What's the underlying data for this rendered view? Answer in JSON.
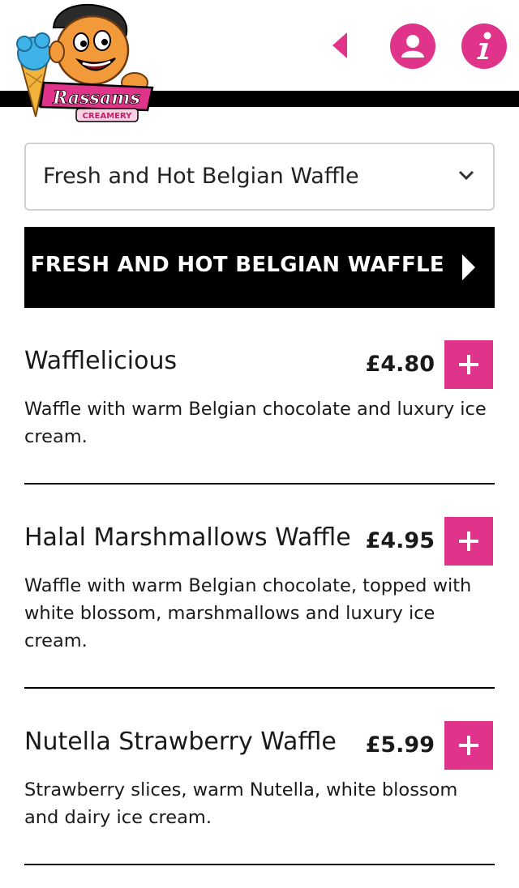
{
  "header": {
    "logo": {
      "brand": "Rassams",
      "sub": "CREAMERY"
    },
    "icons": {
      "back": "back-arrow-icon",
      "account": "user-icon",
      "info": "info-icon"
    },
    "accent_color": "#e0338a"
  },
  "category_select": {
    "selected": "Fresh and Hot Belgian Waffle",
    "icon": "chevron-down-icon"
  },
  "category_header": {
    "title": "FRESH AND HOT BELGIAN WAFFLE",
    "icon": "chevron-right-icon"
  },
  "menu": {
    "items": [
      {
        "name": "Wafflelicious",
        "price": "£4.80",
        "description": "Waffle with warm Belgian chocolate and luxury ice cream.",
        "add_label": "+"
      },
      {
        "name": "Halal Marshmallows Waffle",
        "price": "£4.95",
        "description": "Waffle with warm Belgian chocolate, topped with white blossom, marshmallows and luxury ice cream.",
        "add_label": "+"
      },
      {
        "name": "Nutella Strawberry Waffle",
        "price": "£5.99",
        "description": "Strawberry slices, warm Nutella, white blossom and dairy ice cream.",
        "add_label": "+"
      }
    ]
  }
}
